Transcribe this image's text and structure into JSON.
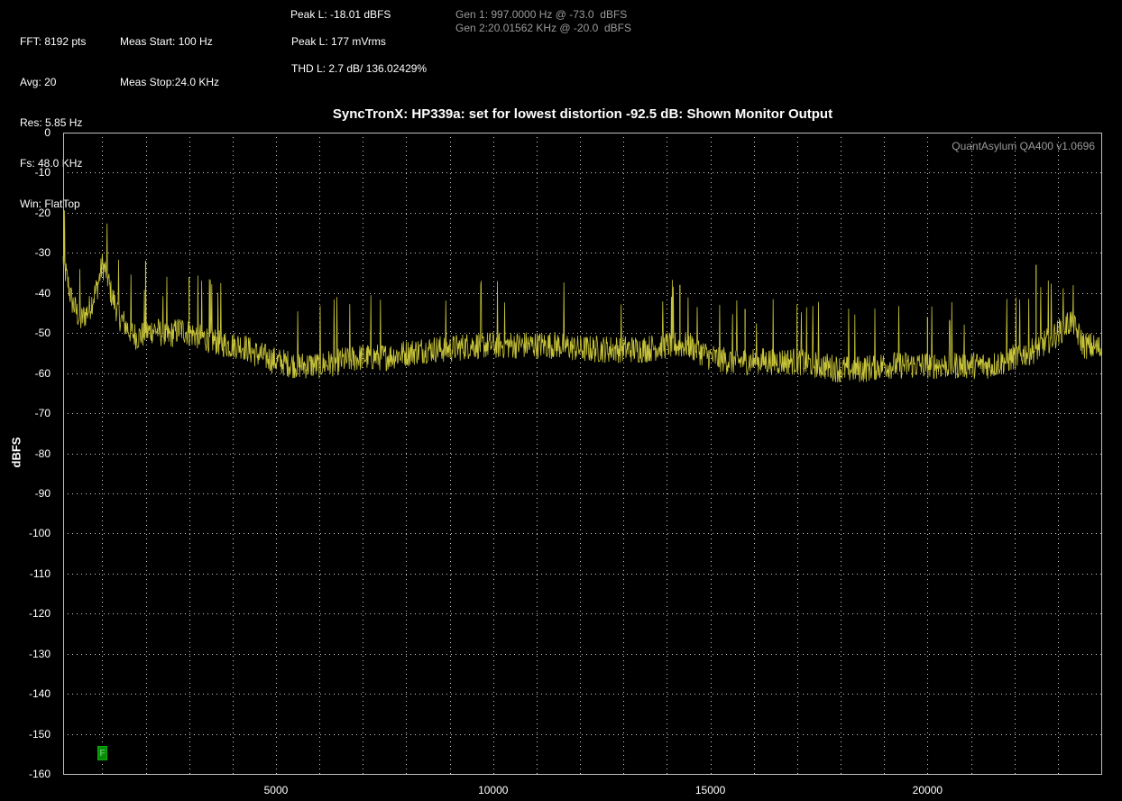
{
  "header": {
    "col1": [
      "FFT: 8192 pts",
      "Avg: 20",
      "Res: 5.85 Hz",
      "Fs: 48.0 KHz",
      "Win: FlatTop"
    ],
    "col2": [
      "Meas Start: 100 Hz",
      "Meas Stop:24.0 KHz"
    ],
    "peak_dbfs": "Peak L: -18.01 dBFS",
    "peak_mvrms": "Peak L: 177 mVrms",
    "thd": "THD L: 2.7 dB/ 136.02429%",
    "gen1": "Gen 1: 997.0000 Hz @ -73.0  dBFS",
    "gen2": "Gen 2:20.01562 KHz @ -20.0  dBFS"
  },
  "watermark": "QuantAsylum QA400 v1.0696",
  "marker_label": "F",
  "chart_data": {
    "type": "line",
    "title": "SyncTronX: HP339a: set for lowest distortion -92.5 dB: Shown Monitor Output",
    "xlabel": "",
    "ylabel": "dBFS",
    "xlim": [
      100,
      24000
    ],
    "ylim": [
      -160,
      0
    ],
    "xticks": [
      5000,
      10000,
      15000,
      20000
    ],
    "yticks": [
      0,
      -10,
      -20,
      -30,
      -40,
      -50,
      -60,
      -70,
      -80,
      -90,
      -100,
      -110,
      -120,
      -130,
      -140,
      -150,
      -160
    ],
    "grid": true,
    "line_color": "#c8c43a",
    "series": [
      {
        "x": [
          100,
          300,
          500,
          700,
          900,
          1000,
          1100,
          1200,
          1400,
          1600,
          1800,
          2000,
          2200,
          2500,
          2800,
          3000,
          3300,
          3600,
          3900,
          4200,
          4500,
          5000,
          5500,
          6000,
          6500,
          7000,
          7500,
          8000,
          8500,
          9000,
          9500,
          10000,
          10500,
          11000,
          11500,
          12000,
          12500,
          13000,
          13500,
          14000,
          14500,
          15000,
          15500,
          16000,
          16500,
          17000,
          17500,
          18000,
          18500,
          19000,
          19500,
          20000,
          20500,
          21000,
          21500,
          22000,
          22500,
          23000,
          23300,
          23600,
          24000
        ],
        "values": [
          -32,
          -42,
          -47,
          -44,
          -38,
          -33,
          -35,
          -40,
          -46,
          -49,
          -51,
          -50,
          -49,
          -51,
          -49,
          -50,
          -51,
          -52,
          -53,
          -53,
          -55,
          -57,
          -58,
          -58,
          -57,
          -56,
          -56,
          -55,
          -54,
          -54,
          -53,
          -53,
          -53,
          -53,
          -53,
          -54,
          -54,
          -54,
          -54,
          -53,
          -53,
          -56,
          -57,
          -57,
          -57,
          -57,
          -58,
          -59,
          -59,
          -58,
          -58,
          -58,
          -58,
          -58,
          -58,
          -56,
          -54,
          -50,
          -47,
          -53,
          -54
        ]
      }
    ],
    "spikes": [
      {
        "x": 2000,
        "y": -32
      },
      {
        "x": 3000,
        "y": -36
      },
      {
        "x": 14300,
        "y": -38
      },
      {
        "x": 15800,
        "y": -44
      },
      {
        "x": 20000,
        "y": -46
      },
      {
        "x": 22500,
        "y": -33
      }
    ]
  }
}
